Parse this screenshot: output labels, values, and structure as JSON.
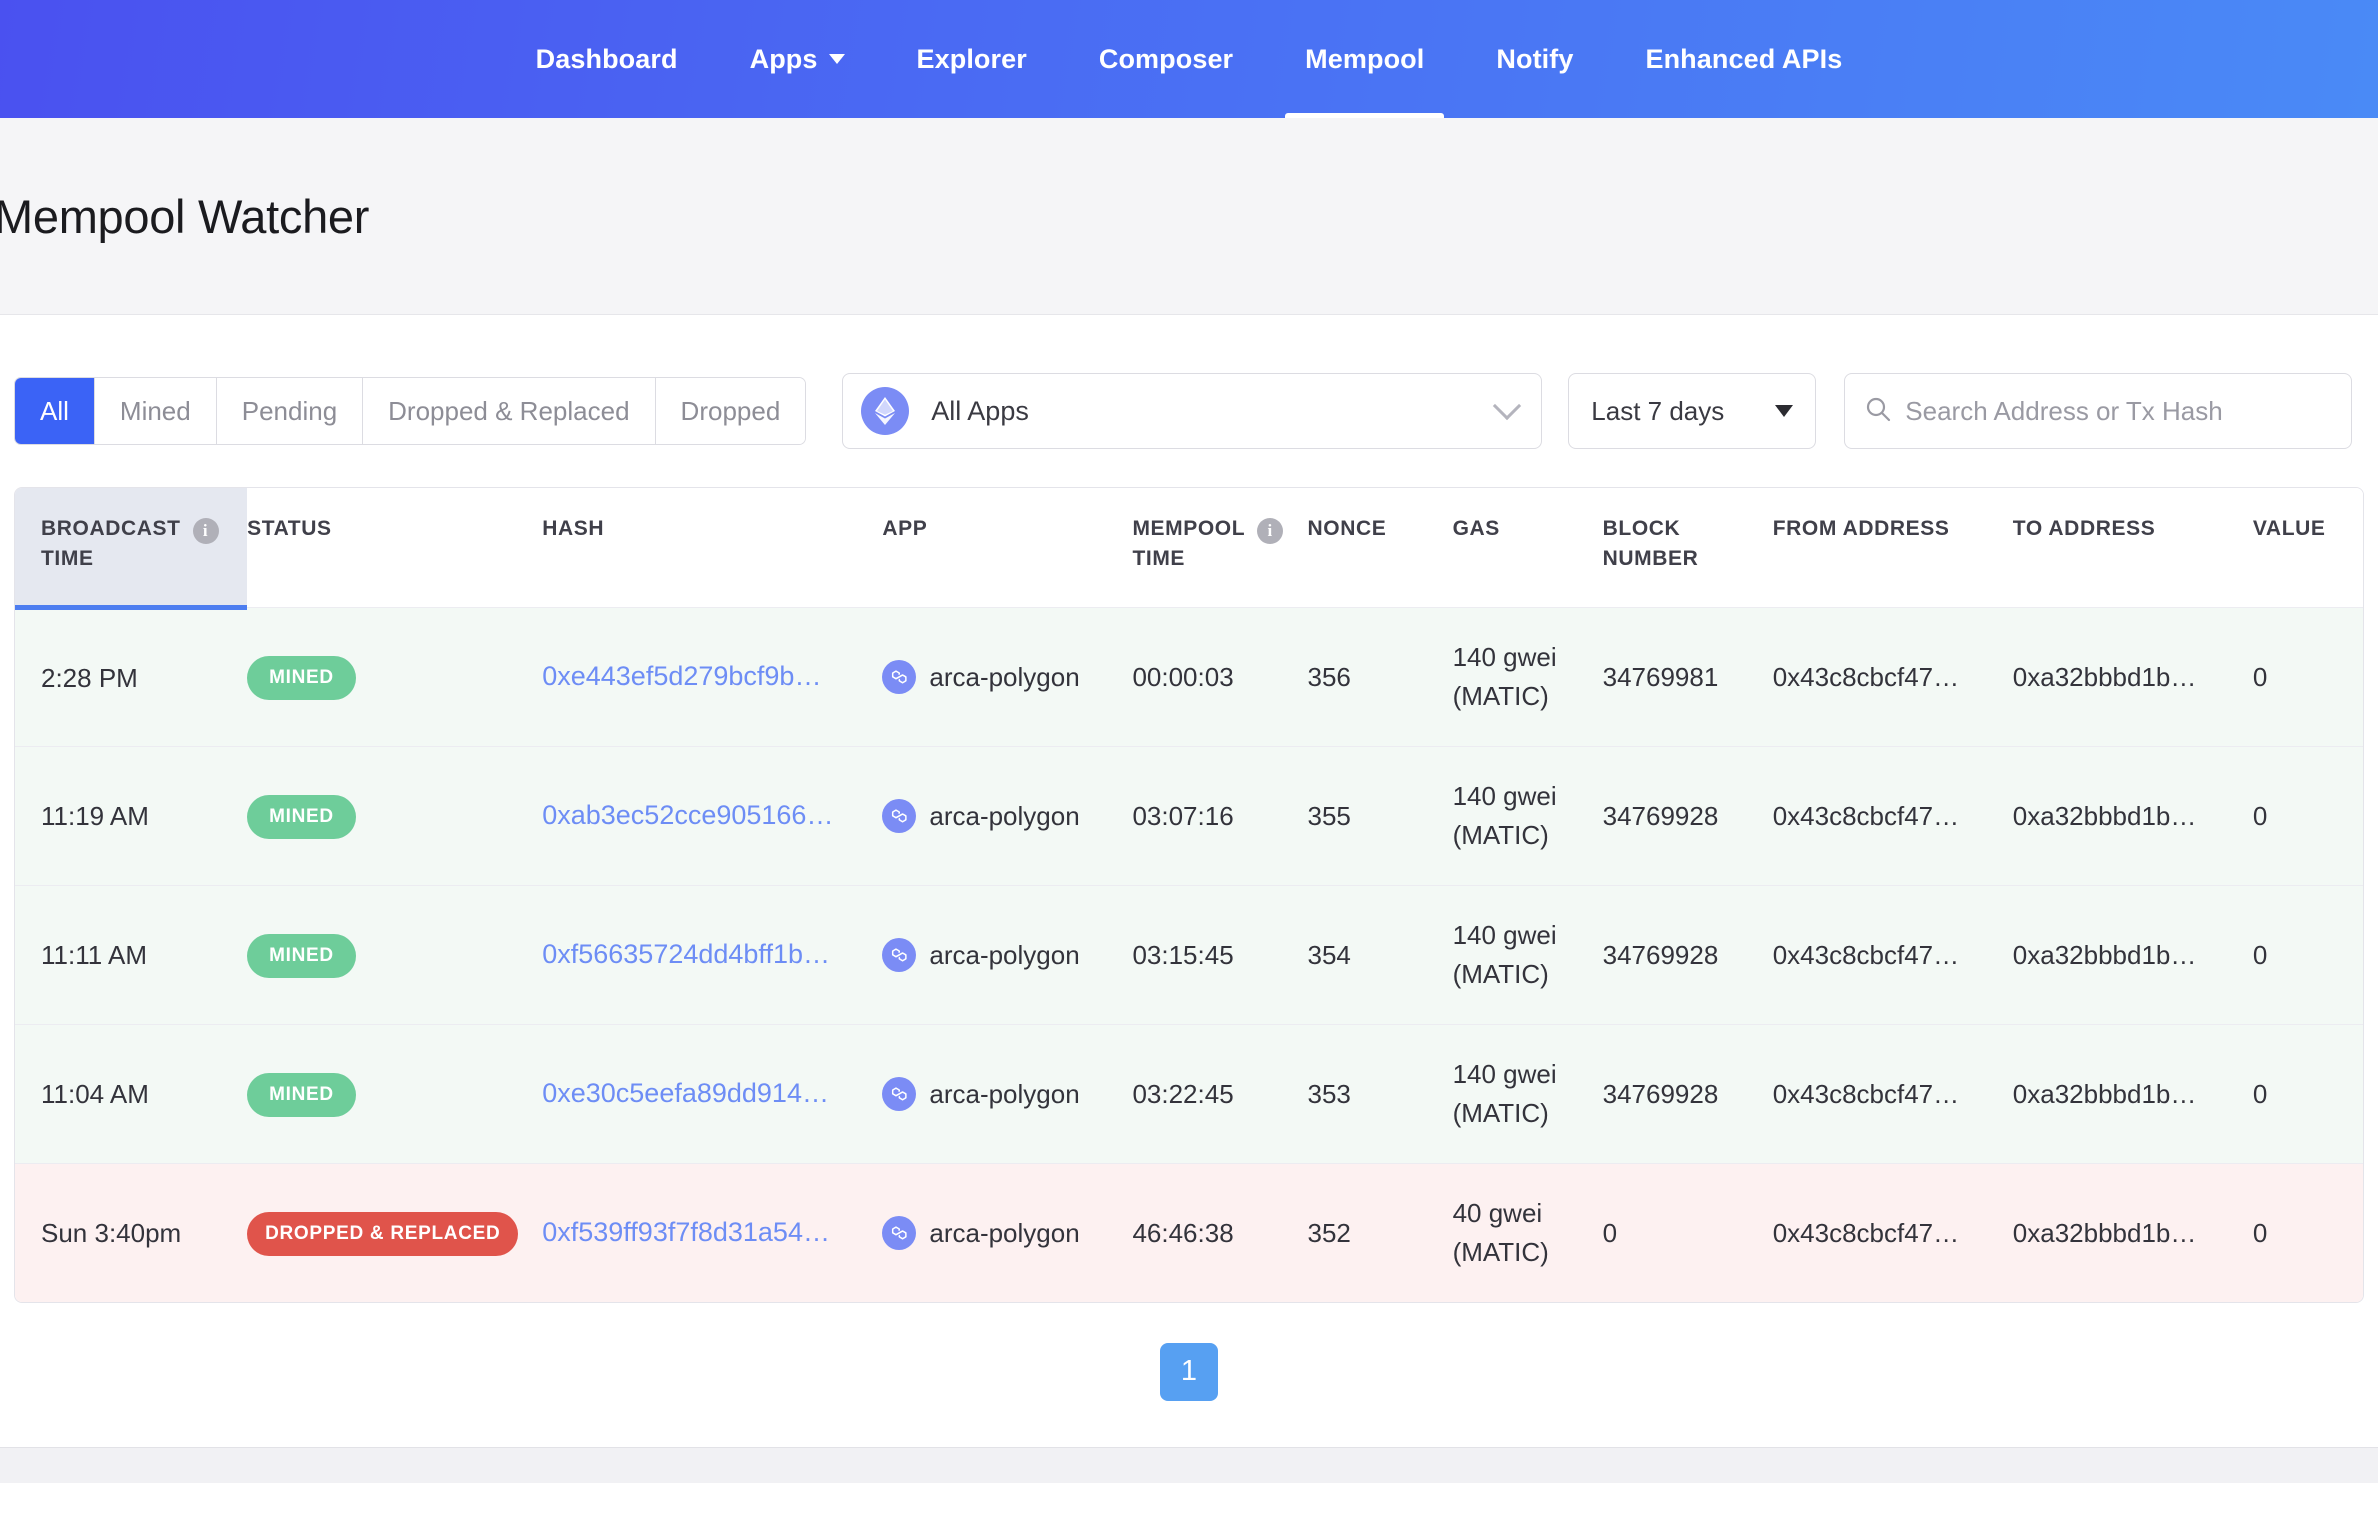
{
  "nav": {
    "items": [
      {
        "label": "Dashboard",
        "active": false,
        "has_caret": false
      },
      {
        "label": "Apps",
        "active": false,
        "has_caret": true
      },
      {
        "label": "Explorer",
        "active": false,
        "has_caret": false
      },
      {
        "label": "Composer",
        "active": false,
        "has_caret": false
      },
      {
        "label": "Mempool",
        "active": true,
        "has_caret": false
      },
      {
        "label": "Notify",
        "active": false,
        "has_caret": false
      },
      {
        "label": "Enhanced APIs",
        "active": false,
        "has_caret": false
      }
    ],
    "accent_gradient_from": "#4a51f0",
    "accent_gradient_to": "#4a8af6"
  },
  "page": {
    "title": "Mempool Watcher"
  },
  "filters": {
    "status_tabs": [
      {
        "label": "All",
        "active": true
      },
      {
        "label": "Mined",
        "active": false
      },
      {
        "label": "Pending",
        "active": false
      },
      {
        "label": "Dropped & Replaced",
        "active": false
      },
      {
        "label": "Dropped",
        "active": false
      }
    ],
    "active_tab_color": "#3b63f6",
    "app_select": {
      "value": "All Apps",
      "icon": "ethereum-icon"
    },
    "date_select": {
      "value": "Last 7 days"
    },
    "search": {
      "value": "",
      "placeholder": "Search Address or Tx Hash",
      "icon": "search-icon"
    }
  },
  "table": {
    "columns": [
      {
        "label": "BROADCAST TIME",
        "line1": "BROADCAST",
        "line2": "TIME",
        "has_info": true,
        "sorted": true
      },
      {
        "label": "STATUS",
        "line1": "STATUS",
        "line2": "",
        "has_info": false,
        "sorted": false
      },
      {
        "label": "HASH",
        "line1": "HASH",
        "line2": "",
        "has_info": false,
        "sorted": false
      },
      {
        "label": "APP",
        "line1": "APP",
        "line2": "",
        "has_info": false,
        "sorted": false
      },
      {
        "label": "MEMPOOL TIME",
        "line1": "MEMPOOL",
        "line2": "TIME",
        "has_info": true,
        "sorted": false
      },
      {
        "label": "NONCE",
        "line1": "NONCE",
        "line2": "",
        "has_info": false,
        "sorted": false
      },
      {
        "label": "GAS",
        "line1": "GAS",
        "line2": "",
        "has_info": false,
        "sorted": false
      },
      {
        "label": "BLOCK NUMBER",
        "line1": "BLOCK",
        "line2": "NUMBER",
        "has_info": false,
        "sorted": false
      },
      {
        "label": "FROM ADDRESS",
        "line1": "FROM ADDRESS",
        "line2": "",
        "has_info": false,
        "sorted": false
      },
      {
        "label": "TO ADDRESS",
        "line1": "TO ADDRESS",
        "line2": "",
        "has_info": false,
        "sorted": false
      },
      {
        "label": "VALUE",
        "line1": "VALUE",
        "line2": "",
        "has_info": false,
        "sorted": false
      }
    ],
    "rows": [
      {
        "broadcast_time": "2:28 PM",
        "status": "MINED",
        "status_kind": "mined",
        "hash": "0xe443ef5d279bcf9b…",
        "app": "arca-polygon",
        "mempool_time": "00:00:03",
        "nonce": "356",
        "gas": "140 gwei (MATIC)",
        "block_number": "34769981",
        "from_address": "0x43c8cbcf47…",
        "to_address": "0xa32bbbd1b…",
        "value": "0"
      },
      {
        "broadcast_time": "11:19 AM",
        "status": "MINED",
        "status_kind": "mined",
        "hash": "0xab3ec52cce905166…",
        "app": "arca-polygon",
        "mempool_time": "03:07:16",
        "nonce": "355",
        "gas": "140 gwei (MATIC)",
        "block_number": "34769928",
        "from_address": "0x43c8cbcf47…",
        "to_address": "0xa32bbbd1b…",
        "value": "0"
      },
      {
        "broadcast_time": "11:11 AM",
        "status": "MINED",
        "status_kind": "mined",
        "hash": "0xf56635724dd4bff1b…",
        "app": "arca-polygon",
        "mempool_time": "03:15:45",
        "nonce": "354",
        "gas": "140 gwei (MATIC)",
        "block_number": "34769928",
        "from_address": "0x43c8cbcf47…",
        "to_address": "0xa32bbbd1b…",
        "value": "0"
      },
      {
        "broadcast_time": "11:04 AM",
        "status": "MINED",
        "status_kind": "mined",
        "hash": "0xe30c5eefa89dd914…",
        "app": "arca-polygon",
        "mempool_time": "03:22:45",
        "nonce": "353",
        "gas": "140 gwei (MATIC)",
        "block_number": "34769928",
        "from_address": "0x43c8cbcf47…",
        "to_address": "0xa32bbbd1b…",
        "value": "0"
      },
      {
        "broadcast_time": "Sun 3:40pm",
        "status": "DROPPED & REPLACED",
        "status_kind": "dropped",
        "hash": "0xf539ff93f7f8d31a54…",
        "app": "arca-polygon",
        "mempool_time": "46:46:38",
        "nonce": "352",
        "gas": "40 gwei (MATIC)",
        "block_number": "0",
        "from_address": "0x43c8cbcf47…",
        "to_address": "0xa32bbbd1b…",
        "value": "0"
      }
    ],
    "status_colors": {
      "mined": "#6ecd9a",
      "dropped": "#e0544b"
    }
  },
  "pagination": {
    "pages": [
      "1"
    ],
    "current": "1",
    "active_color": "#57a0f2"
  }
}
